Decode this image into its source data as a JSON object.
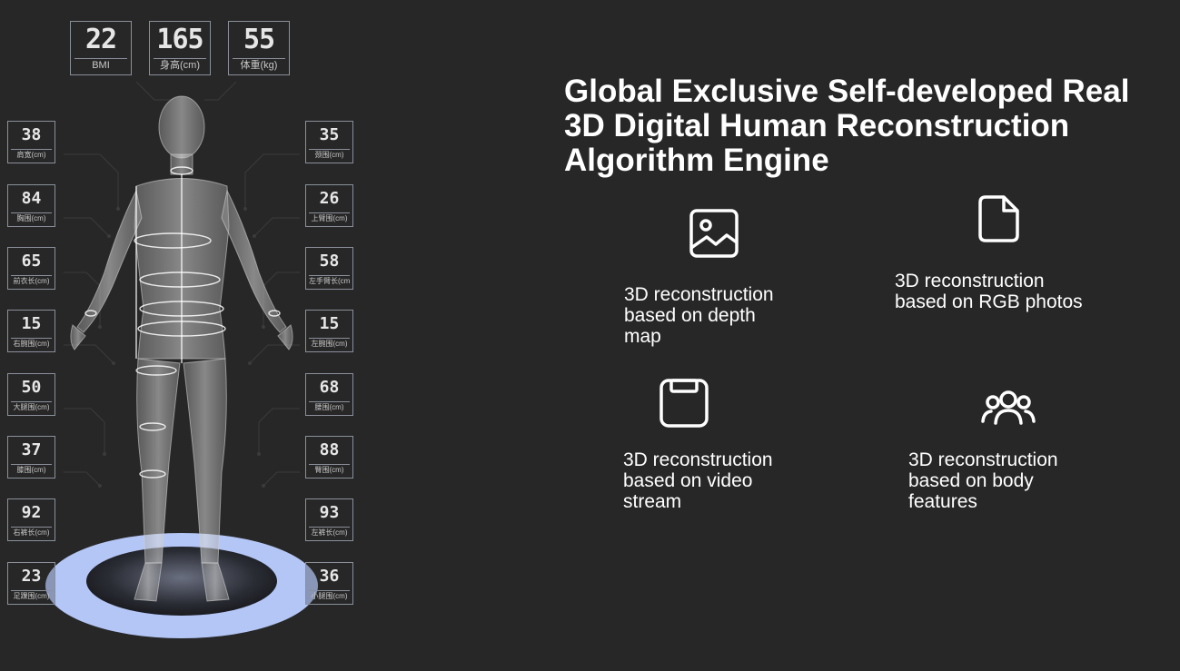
{
  "top_metrics": [
    {
      "value": "22",
      "label": "BMI"
    },
    {
      "value": "165",
      "label": "身高(cm)"
    },
    {
      "value": "55",
      "label": "体重(kg)"
    }
  ],
  "left_metrics": [
    {
      "value": "38",
      "label": "肩宽(cm)"
    },
    {
      "value": "84",
      "label": "胸围(cm)"
    },
    {
      "value": "65",
      "label": "前衣长(cm)"
    },
    {
      "value": "15",
      "label": "右腕围(cm)"
    },
    {
      "value": "50",
      "label": "大腿围(cm)"
    },
    {
      "value": "37",
      "label": "膝围(cm)"
    },
    {
      "value": "92",
      "label": "右裤长(cm)"
    },
    {
      "value": "23",
      "label": "足踝围(cm)"
    }
  ],
  "right_metrics": [
    {
      "value": "35",
      "label": "颈围(cm)"
    },
    {
      "value": "26",
      "label": "上臂围(cm)"
    },
    {
      "value": "58",
      "label": "左手臂长(cm)"
    },
    {
      "value": "15",
      "label": "左腕围(cm)"
    },
    {
      "value": "68",
      "label": "腰围(cm)"
    },
    {
      "value": "88",
      "label": "臀围(cm)"
    },
    {
      "value": "93",
      "label": "左裤长(cm)"
    },
    {
      "value": "36",
      "label": "小腿围(cm)"
    }
  ],
  "heading": {
    "line1": "Global Exclusive Self-developed Real",
    "line2": "3D Digital Human Reconstruction",
    "line3": "Algorithm Engine"
  },
  "features": [
    {
      "icon": "image-icon",
      "lines": [
        "3D reconstruction",
        "based on depth",
        "map"
      ]
    },
    {
      "icon": "document-icon",
      "lines": [
        "3D reconstruction",
        "based on RGB photos"
      ]
    },
    {
      "icon": "video-stream-icon",
      "lines": [
        "3D reconstruction",
        "based on video",
        "stream"
      ]
    },
    {
      "icon": "users-icon",
      "lines": [
        "3D reconstruction",
        "based on body",
        "features"
      ]
    }
  ],
  "colors": {
    "background": "#272727",
    "platform": "#b4c6f6",
    "text": "#ffffff"
  }
}
